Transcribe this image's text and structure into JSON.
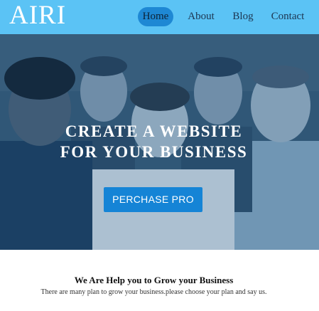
{
  "header": {
    "logo": "AIRI",
    "nav": [
      {
        "label": "Home",
        "active": true
      },
      {
        "label": "About",
        "active": false
      },
      {
        "label": "Blog",
        "active": false
      },
      {
        "label": "Contact",
        "active": false
      }
    ],
    "colors": {
      "bar": "#5bc3f5",
      "active_pill": "#1e88d4"
    }
  },
  "hero": {
    "title_line1": "CREATE A WEBSITE",
    "title_line2": "FOR YOUR BUSINESS",
    "cta_label": "PERCHASE PRO",
    "image_icon": "team-photo",
    "colors": {
      "cta": "#1584d6",
      "tint": "#1f4260"
    }
  },
  "section": {
    "title": "We Are Help you to Grow your Business",
    "subtitle": "There are many plan to grow your business.please choose your plan and say us."
  }
}
